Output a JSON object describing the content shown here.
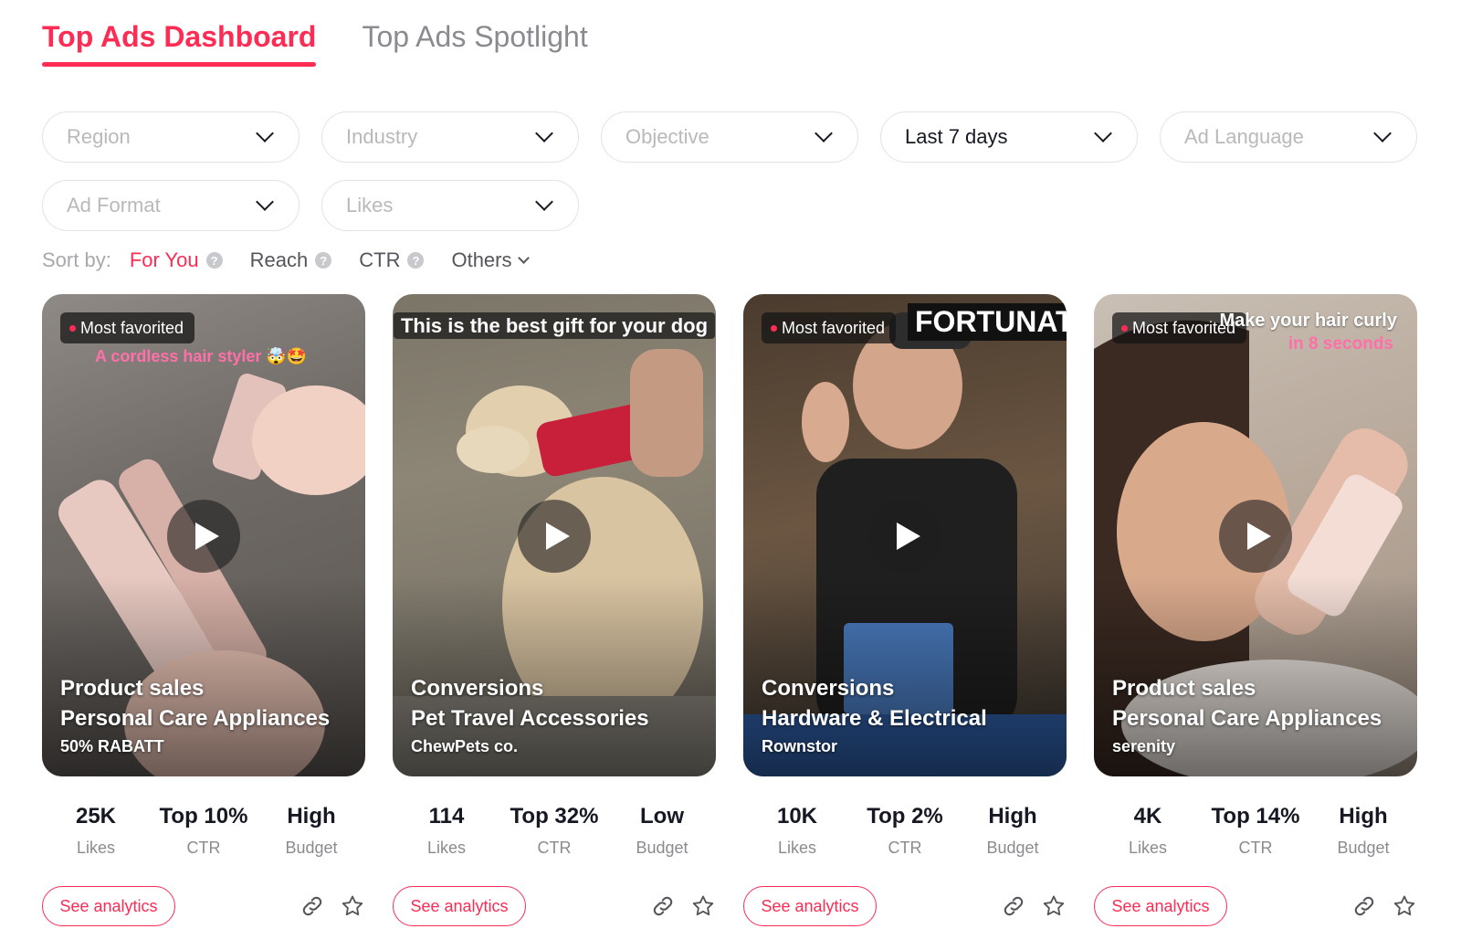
{
  "tabs": [
    {
      "label": "Top Ads Dashboard"
    },
    {
      "label": "Top Ads Spotlight"
    }
  ],
  "filters": [
    {
      "label": "Region",
      "selected": false
    },
    {
      "label": "Industry",
      "selected": false
    },
    {
      "label": "Objective",
      "selected": false
    },
    {
      "label": "Last 7 days",
      "selected": true
    },
    {
      "label": "Ad Language",
      "selected": false
    },
    {
      "label": "Ad Format",
      "selected": false
    },
    {
      "label": "Likes",
      "selected": false
    }
  ],
  "sort": {
    "label": "Sort by:",
    "options": [
      {
        "label": "For You",
        "active": true
      },
      {
        "label": "Reach",
        "active": false
      },
      {
        "label": "CTR",
        "active": false
      },
      {
        "label": "Others",
        "active": false
      }
    ]
  },
  "colors": {
    "accent": "#fe2c55"
  },
  "cards": [
    {
      "badge": "Most favorited",
      "caption": "A cordless hair styler 🤯🤩",
      "objective": "Product sales",
      "industry": "Personal Care Appliances",
      "brand": "50% RABATT",
      "likes": "25K",
      "likes_label": "Likes",
      "ctr": "Top 10%",
      "ctr_label": "CTR",
      "budget": "High",
      "budget_label": "Budget",
      "button": "See analytics"
    },
    {
      "badge": "",
      "caption": "This is the best gift for your dog",
      "objective": "Conversions",
      "industry": "Pet Travel Accessories",
      "brand": "ChewPets co.",
      "likes": "114",
      "likes_label": "Likes",
      "ctr": "Top 32%",
      "ctr_label": "CTR",
      "budget": "Low",
      "budget_label": "Budget",
      "button": "See analytics"
    },
    {
      "badge": "Most favorited",
      "caption": "FORTUNATI",
      "objective": "Conversions",
      "industry": "Hardware & Electrical",
      "brand": "Rownstor",
      "likes": "10K",
      "likes_label": "Likes",
      "ctr": "Top 2%",
      "ctr_label": "CTR",
      "budget": "High",
      "budget_label": "Budget",
      "button": "See analytics"
    },
    {
      "badge": "Most favorited",
      "caption": "Make your hair curly",
      "caption2": "in 8 seconds",
      "objective": "Product sales",
      "industry": "Personal Care Appliances",
      "brand": "serenity",
      "likes": "4K",
      "likes_label": "Likes",
      "ctr": "Top 14%",
      "ctr_label": "CTR",
      "budget": "High",
      "budget_label": "Budget",
      "button": "See analytics"
    }
  ]
}
